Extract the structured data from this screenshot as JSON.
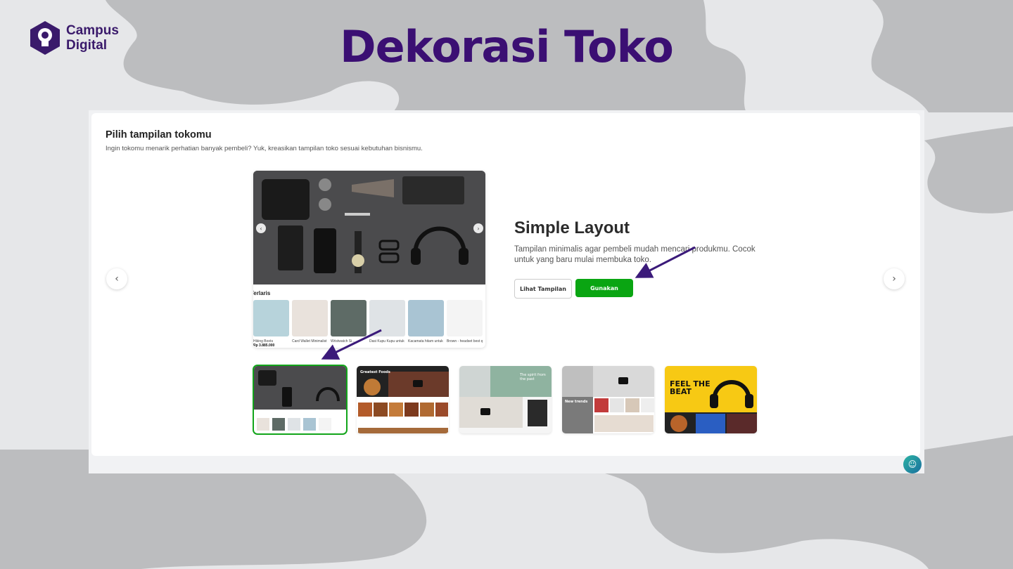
{
  "slide": {
    "title": "Dekorasi Toko",
    "logo_line1": "Campus",
    "logo_line2": "Digital"
  },
  "screen": {
    "heading": "Pilih tampilan tokomu",
    "subheading": "Ingin tokomu menarik perhatian banyak pembeli? Yuk, kreasikan tampilan toko sesuai kebutuhan bisnismu.",
    "layout": {
      "name": "Simple Layout",
      "description": "Tampilan minimalis agar pembeli mudah mencari produkmu. Cocok untuk yang baru mulai membuka toko."
    },
    "buttons": {
      "preview_label": "Lihat Tampilan",
      "use_label": "Gunakan"
    },
    "preview": {
      "section_label": "Terlaris",
      "products": [
        {
          "name": "Hiking Boots",
          "price": "Rp 3.885.000"
        },
        {
          "name": "Card Wallet Minimalist Design",
          "price": ""
        },
        {
          "name": "Wristwatch Si...",
          "price": ""
        },
        {
          "name": "Dasi Kupu Kupu untuk acara formal",
          "price": ""
        },
        {
          "name": "Kacamata hitam untuk pria",
          "price": ""
        },
        {
          "name": "Brown - headset best quality",
          "price": ""
        }
      ]
    },
    "thumbnails": [
      {
        "name": "simple-layout",
        "selected": true
      },
      {
        "name": "food-layout",
        "selected": false,
        "label": "Greatest Foods"
      },
      {
        "name": "interior-layout",
        "selected": false,
        "label": "The spirit from the past"
      },
      {
        "name": "fashion-layout",
        "selected": false,
        "label": "New trends"
      },
      {
        "name": "music-layout",
        "selected": false,
        "label": "FEEL THE BEAT"
      }
    ]
  },
  "colors": {
    "title_purple": "#3b0f73",
    "primary_green": "#0aa512",
    "annotation_arrow": "#3b1a7a"
  }
}
